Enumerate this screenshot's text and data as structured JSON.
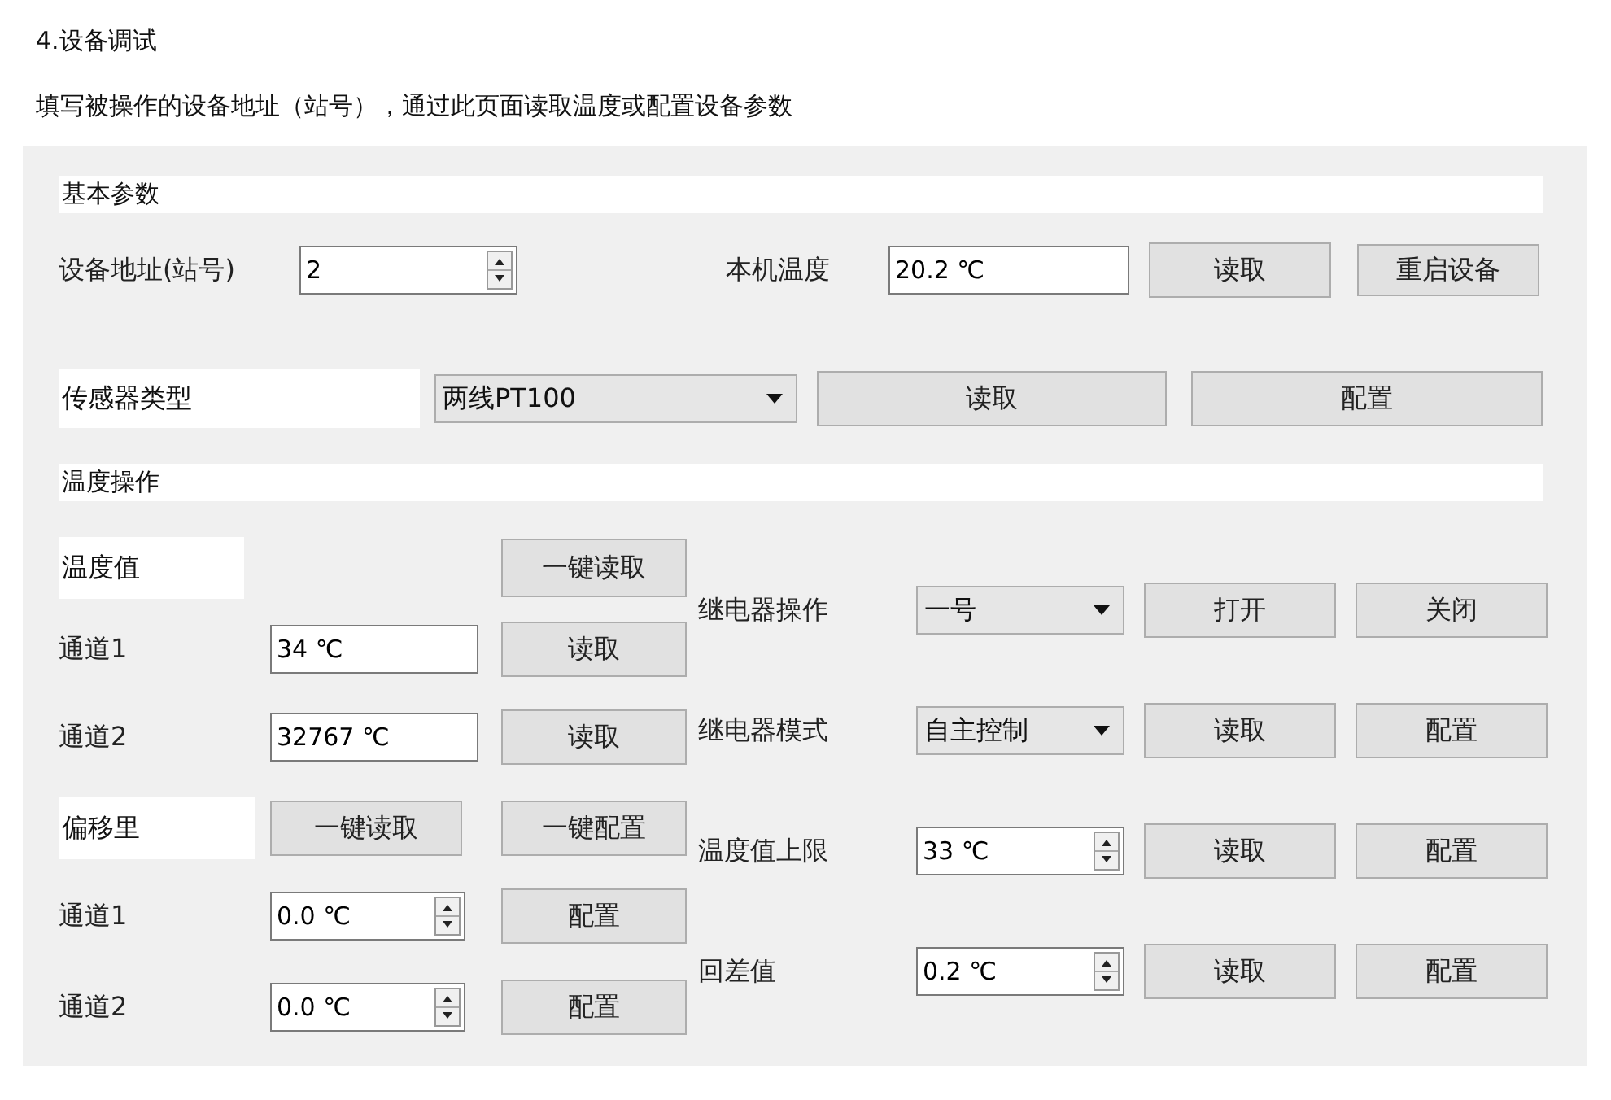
{
  "heading": "4.设备调试",
  "intro": "填写被操作的设备地址（站号），通过此页面读取温度或配置设备参数",
  "basic": {
    "title": "基本参数",
    "address": {
      "label": "设备地址(站号)",
      "value": "2"
    },
    "local_temp": {
      "label": "本机温度",
      "value": "20.2 ℃",
      "buttons": [
        "读取",
        "重启设备"
      ]
    },
    "sensor": {
      "label": "传感器类型",
      "value": "两线PT100",
      "buttons": [
        "读取",
        "配置"
      ]
    }
  },
  "temperature": {
    "title": "温度操作",
    "values": {
      "label": "温度值",
      "button": "一键读取",
      "channels": [
        {
          "label": "通道1",
          "value": "34 ℃",
          "button": "读取"
        },
        {
          "label": "通道2",
          "value": "32767 ℃",
          "button": "读取"
        }
      ]
    },
    "offsets": {
      "label": "偏移里",
      "buttons": [
        "一键读取",
        "一键配置"
      ],
      "channels": [
        {
          "label": "通道1",
          "value": "0.0 ℃",
          "button": "配置"
        },
        {
          "label": "通道2",
          "value": "0.0 ℃",
          "button": "配置"
        }
      ]
    },
    "controls": [
      {
        "kind": "dropdown",
        "label": "继电器操作",
        "value": "一号",
        "buttons": [
          "打开",
          "关闭"
        ]
      },
      {
        "kind": "dropdown",
        "label": "继电器模式",
        "value": "自主控制",
        "buttons": [
          "读取",
          "配置"
        ]
      },
      {
        "kind": "spinbox",
        "label": "温度值上限",
        "value": "33 ℃",
        "buttons": [
          "读取",
          "配置"
        ]
      },
      {
        "kind": "spinbox",
        "label": "回差值",
        "value": "0.2 ℃",
        "buttons": [
          "读取",
          "配置"
        ]
      }
    ]
  }
}
